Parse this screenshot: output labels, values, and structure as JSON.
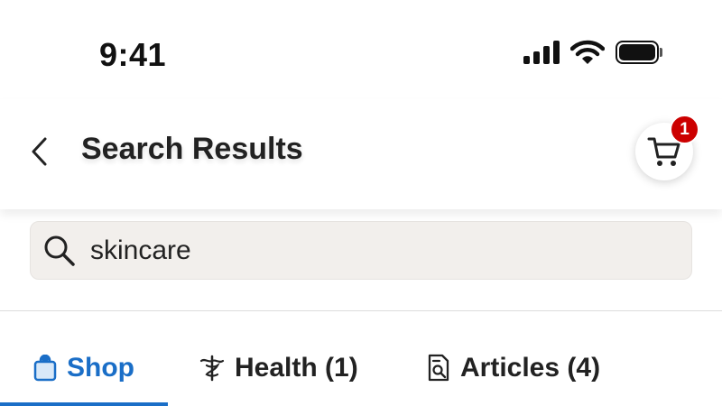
{
  "status_bar": {
    "time": "9:41"
  },
  "header": {
    "title": "Search Results",
    "cart_count": "1"
  },
  "search": {
    "value": "skincare",
    "icon": "search-icon"
  },
  "tabs": [
    {
      "label": "Shop",
      "icon": "shopping-bag-icon",
      "active": true
    },
    {
      "label": "Health (1)",
      "icon": "health-caduceus-icon",
      "active": false
    },
    {
      "label": "Articles (4)",
      "icon": "article-search-icon",
      "active": false
    }
  ],
  "colors": {
    "accent": "#1a6ec7",
    "badge": "#cc0000",
    "search_bg": "#f2efec"
  }
}
